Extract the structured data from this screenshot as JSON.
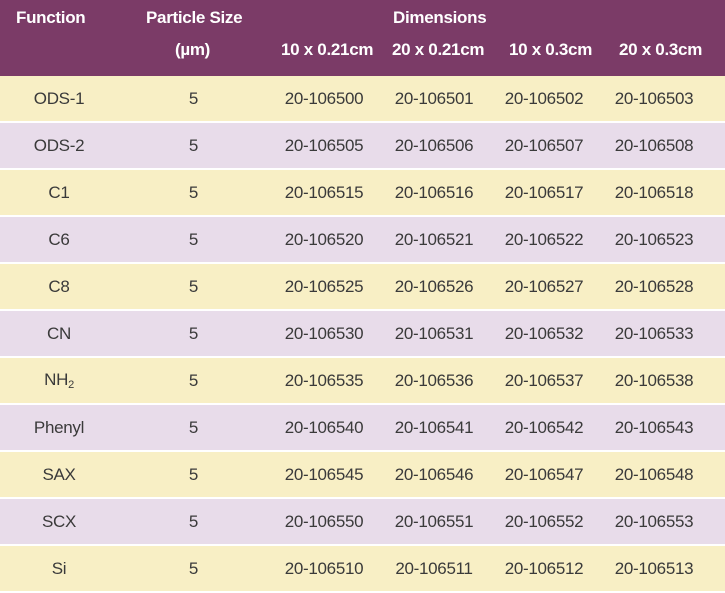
{
  "header": {
    "function": "Function",
    "particle_size": "Particle Size",
    "particle_unit": "(µm)",
    "dimensions": "Dimensions",
    "dims": [
      "10 x 0.21cm",
      "20 x 0.21cm",
      "10 x 0.3cm",
      "20 x 0.3cm"
    ]
  },
  "colors": {
    "header_bg": "#7b3b67",
    "row_yellow": "#f8efc5",
    "row_purple": "#e8dcea"
  },
  "rows": [
    {
      "function": "ODS-1",
      "size": "5",
      "d1": "20-106500",
      "d2": "20-106501",
      "d3": "20-106502",
      "d4": "20-106503"
    },
    {
      "function": "ODS-2",
      "size": "5",
      "d1": "20-106505",
      "d2": "20-106506",
      "d3": "20-106507",
      "d4": "20-106508"
    },
    {
      "function": "C1",
      "size": "5",
      "d1": "20-106515",
      "d2": "20-106516",
      "d3": "20-106517",
      "d4": "20-106518"
    },
    {
      "function": "C6",
      "size": "5",
      "d1": "20-106520",
      "d2": "20-106521",
      "d3": "20-106522",
      "d4": "20-106523"
    },
    {
      "function": "C8",
      "size": "5",
      "d1": "20-106525",
      "d2": "20-106526",
      "d3": "20-106527",
      "d4": "20-106528"
    },
    {
      "function": "CN",
      "size": "5",
      "d1": "20-106530",
      "d2": "20-106531",
      "d3": "20-106532",
      "d4": "20-106533"
    },
    {
      "function": "NH",
      "function_sub": "2",
      "size": "5",
      "d1": "20-106535",
      "d2": "20-106536",
      "d3": "20-106537",
      "d4": "20-106538"
    },
    {
      "function": "Phenyl",
      "size": "5",
      "d1": "20-106540",
      "d2": "20-106541",
      "d3": "20-106542",
      "d4": "20-106543"
    },
    {
      "function": "SAX",
      "size": "5",
      "d1": "20-106545",
      "d2": "20-106546",
      "d3": "20-106547",
      "d4": "20-106548"
    },
    {
      "function": "SCX",
      "size": "5",
      "d1": "20-106550",
      "d2": "20-106551",
      "d3": "20-106552",
      "d4": "20-106553"
    },
    {
      "function": "Si",
      "size": "5",
      "d1": "20-106510",
      "d2": "20-106511",
      "d3": "20-106512",
      "d4": "20-106513"
    }
  ]
}
